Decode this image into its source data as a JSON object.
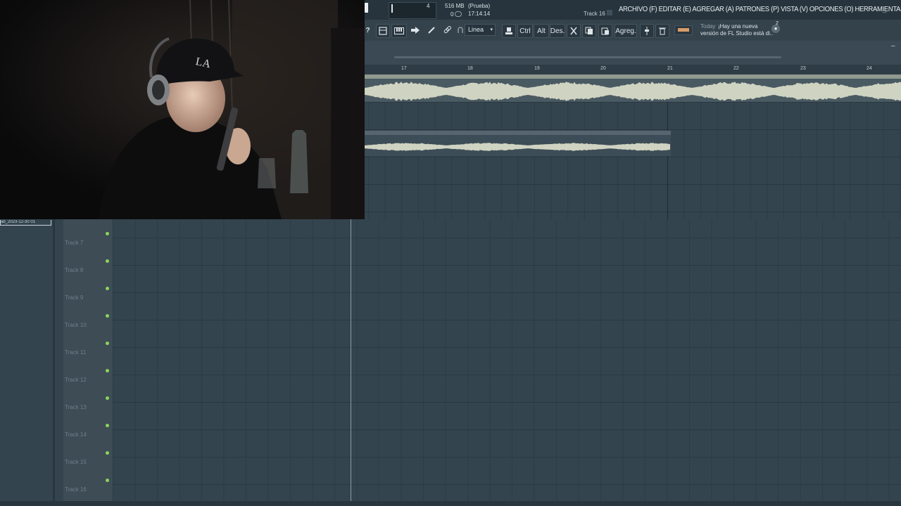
{
  "statusbar": {
    "cpu_value": "4",
    "memory": "516 MB",
    "polyphony": "0",
    "hint_title": "(Prueba)",
    "hint_time": "17:14:14",
    "track_label": "Track 16"
  },
  "menu": {
    "text": "ARCHIVO (F) EDITAR (E) AGREGAR (A) PATRONES (P) VISTA (V) OPCIONES (O) HERRAMIENTAS (T) AYUDA",
    "minimize_glyph": "_"
  },
  "toolbar": {
    "help": "?",
    "snap_value": "Linea",
    "snap_arrow": "▾",
    "ctrl_label": "Ctrl",
    "alt_label": "Alt",
    "des_label": "Des.",
    "agreg_label": "Agreg.",
    "news_today": "Today",
    "news_line1": "¡Hay una nueva",
    "news_line2": "versión de FL Studio está di..",
    "news_count": "2"
  },
  "playlist": {
    "header_dash": "–",
    "ruler_ticks": [
      "17",
      "18",
      "19",
      "20",
      "21",
      "22",
      "23",
      "24"
    ],
    "tracks": [
      "Track 7",
      "Track 8",
      "Track 9",
      "Track 10",
      "Track 11",
      "Track 12",
      "Track 13",
      "Track 14",
      "Track 15",
      "Track 16"
    ],
    "browser_item": "ab_2023-12-30 01"
  },
  "colors": {
    "accent_led": "#8bd45a",
    "clip_wave": "#cfd3c1",
    "swatch": "#d99b6a"
  },
  "icons": [
    "help-icon",
    "pattern-icon",
    "piano-icon",
    "arrow-icon",
    "brush-icon",
    "link-icon",
    "magnet-icon",
    "stamp-icon",
    "scissors-icon",
    "copy-icon",
    "paste-icon",
    "mixer-icon",
    "trash-icon",
    "globe-icon"
  ]
}
